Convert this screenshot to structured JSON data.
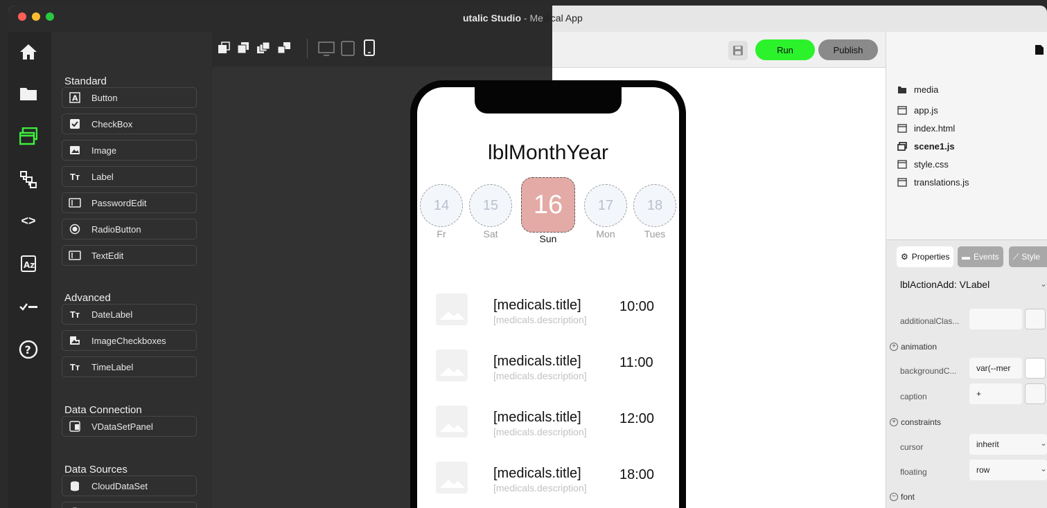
{
  "window": {
    "title_app": "utalic Studio",
    "title_sep": " - ",
    "title_me": "Me",
    "title_rest": "dical App",
    "traffic_colors": [
      "#ff5f57",
      "#febc2e",
      "#28c840"
    ]
  },
  "iconbar": {
    "icons": [
      "home-icon",
      "folder-icon",
      "layers-icon",
      "tree-icon",
      "code-icon",
      "translate-icon",
      "checklist-icon",
      "help-icon"
    ],
    "active_color": "#3cf03c"
  },
  "toolbox": {
    "sections": [
      {
        "title": "Standard",
        "items": [
          {
            "label": "Button",
            "icon": "A"
          },
          {
            "label": "CheckBox",
            "icon": "☑"
          },
          {
            "label": "Image",
            "icon": "▣"
          },
          {
            "label": "Label",
            "icon": "Tт"
          },
          {
            "label": "PasswordEdit",
            "icon": "▭"
          },
          {
            "label": "RadioButton",
            "icon": "◉"
          },
          {
            "label": "TextEdit",
            "icon": "▭"
          }
        ]
      },
      {
        "title": "Advanced",
        "items": [
          {
            "label": "DateLabel",
            "icon": "Tт"
          },
          {
            "label": "ImageCheckboxes",
            "icon": "▣"
          },
          {
            "label": "TimeLabel",
            "icon": "Tт"
          }
        ]
      },
      {
        "title": "Data Connection",
        "items": [
          {
            "label": "VDataSetPanel",
            "icon": "⊟"
          }
        ]
      },
      {
        "title": "Data Sources",
        "items": [
          {
            "label": "CloudDataSet",
            "icon": "⛁"
          }
        ]
      }
    ]
  },
  "toolbar": {
    "run_label": "Run",
    "publish_label": "Publish"
  },
  "phone": {
    "title": "lblMonthYear",
    "days": [
      {
        "num": "14",
        "label": "Fr"
      },
      {
        "num": "15",
        "label": "Sat"
      },
      {
        "num": "17",
        "label": "Mon"
      },
      {
        "num": "18",
        "label": "Tues"
      }
    ],
    "selected_day": {
      "num": "16",
      "label": "Sun"
    },
    "medicals": [
      {
        "title": "[medicals.title]",
        "desc": "[medicals.description]",
        "time": "10:00"
      },
      {
        "title": "[medicals.title]",
        "desc": "[medicals.description]",
        "time": "11:00"
      },
      {
        "title": "[medicals.title]",
        "desc": "[medicals.description]",
        "time": "12:00"
      },
      {
        "title": "[medicals.title]",
        "desc": "[medicals.description]",
        "time": "18:00"
      }
    ]
  },
  "files": [
    {
      "name": "media",
      "type": "folder",
      "bold": false
    },
    {
      "name": "app.js",
      "type": "file",
      "bold": false
    },
    {
      "name": "index.html",
      "type": "file",
      "bold": false
    },
    {
      "name": "scene1.js",
      "type": "scene",
      "bold": true
    },
    {
      "name": "style.css",
      "type": "file",
      "bold": false
    },
    {
      "name": "translations.js",
      "type": "file",
      "bold": false
    }
  ],
  "props": {
    "tabs": {
      "properties": "Properties",
      "events": "Events",
      "style": "Style"
    },
    "component": "lblActionAdd: VLabel",
    "rows": {
      "additional_class": "additionalClas...",
      "animation": "animation",
      "background_color": "backgroundC...",
      "background_color_value": "var(--mer",
      "caption": "caption",
      "caption_value": "+",
      "constraints": "constraints",
      "cursor": "cursor",
      "cursor_value": "inherit",
      "floating": "floating",
      "floating_value": "row",
      "font": "font"
    }
  }
}
